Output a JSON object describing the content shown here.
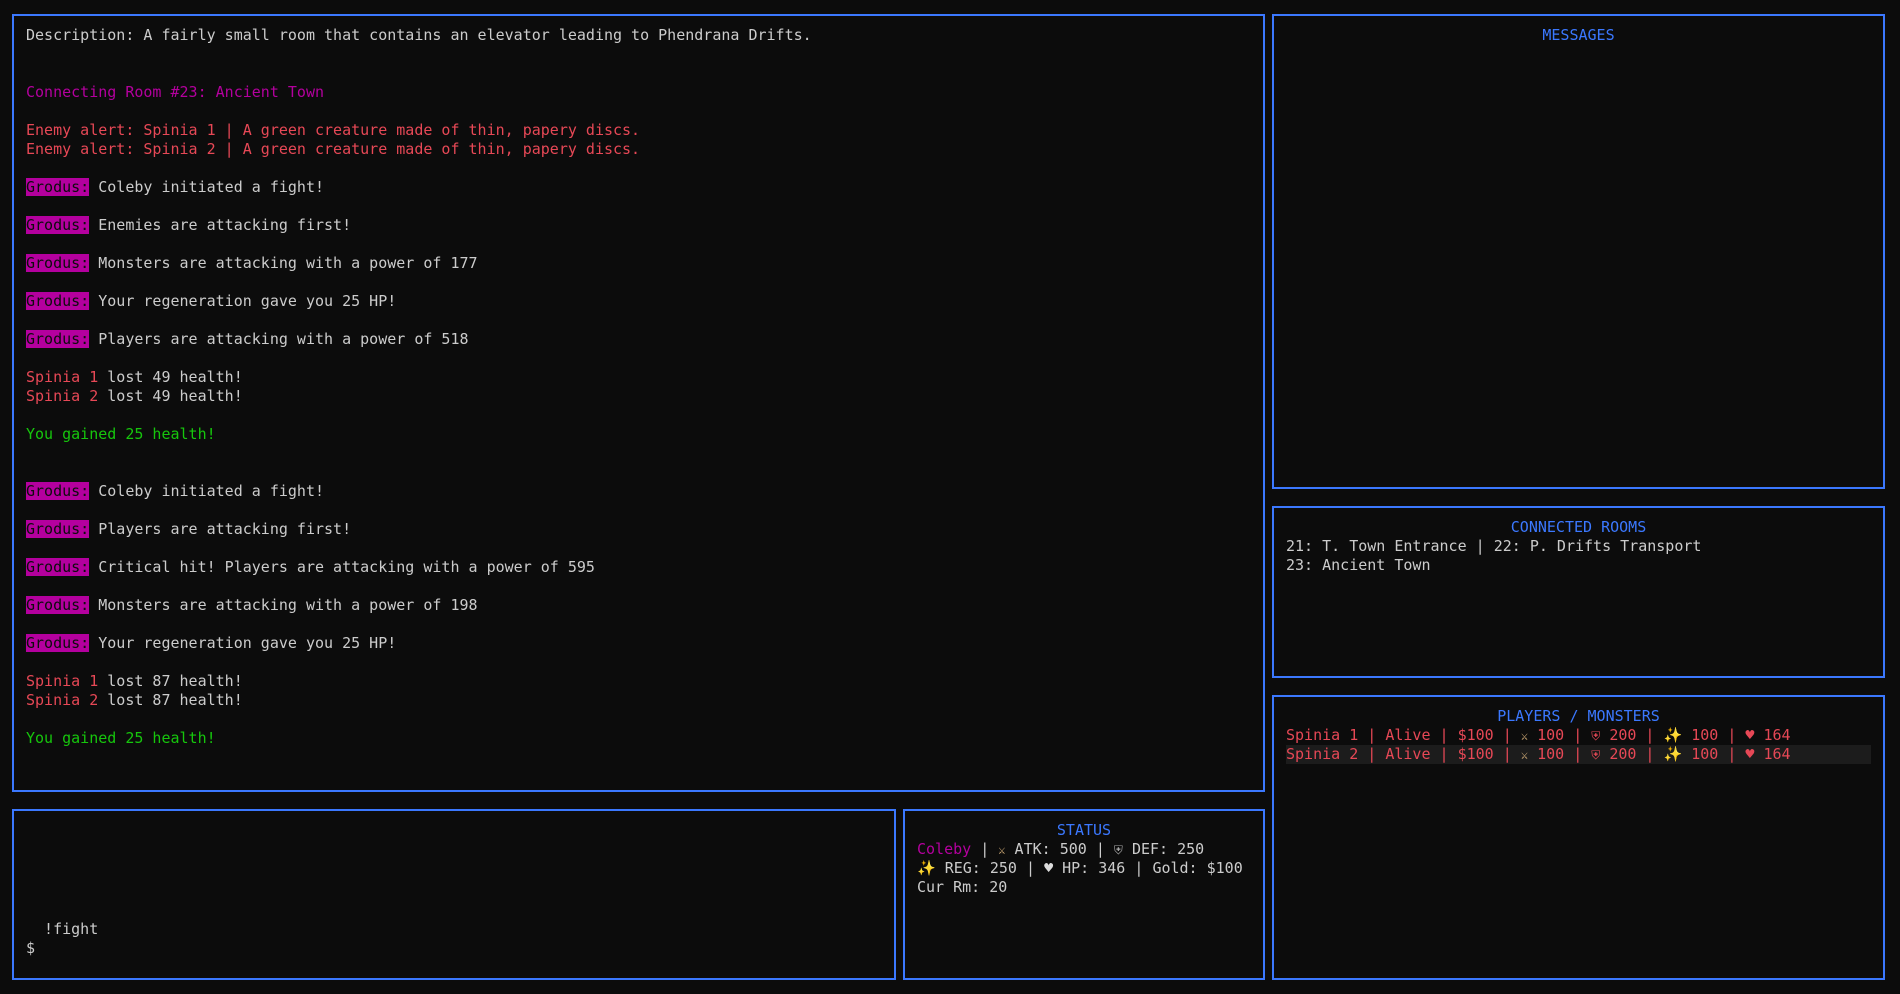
{
  "colors": {
    "border": "#3b78ff",
    "text": "#cccccc",
    "magenta": "#b4009e",
    "red": "#e74856",
    "green": "#16c60c",
    "background": "#0c0c0c"
  },
  "main": {
    "lines": [
      {
        "style": "plain",
        "text": "Description: A fairly small room that contains an elevator leading to Phendrana Drifts."
      },
      {
        "style": "blank"
      },
      {
        "style": "blank"
      },
      {
        "style": "magenta",
        "text": "Connecting Room #23: Ancient Town"
      },
      {
        "style": "blank"
      },
      {
        "style": "red",
        "text": "Enemy alert: Spinia 1 | A green creature made of thin, papery discs."
      },
      {
        "style": "red",
        "text": "Enemy alert: Spinia 2 | A green creature made of thin, papery discs."
      },
      {
        "style": "blank"
      },
      {
        "style": "tag",
        "tag": "Grodus:",
        "text": " Coleby initiated a fight!"
      },
      {
        "style": "blank"
      },
      {
        "style": "tag",
        "tag": "Grodus:",
        "text": " Enemies are attacking first!"
      },
      {
        "style": "blank"
      },
      {
        "style": "tag",
        "tag": "Grodus:",
        "text": " Monsters are attacking with a power of 177"
      },
      {
        "style": "blank"
      },
      {
        "style": "tag",
        "tag": "Grodus:",
        "text": " Your regeneration gave you 25 HP!"
      },
      {
        "style": "blank"
      },
      {
        "style": "tag",
        "tag": "Grodus:",
        "text": " Players are attacking with a power of 518"
      },
      {
        "style": "blank"
      },
      {
        "style": "loss",
        "name": "Spinia 1",
        "text": " lost 49 health!"
      },
      {
        "style": "loss",
        "name": "Spinia 2",
        "text": " lost 49 health!"
      },
      {
        "style": "blank"
      },
      {
        "style": "green",
        "text": "You gained 25 health!"
      },
      {
        "style": "blank"
      },
      {
        "style": "blank"
      },
      {
        "style": "tag",
        "tag": "Grodus:",
        "text": " Coleby initiated a fight!"
      },
      {
        "style": "blank"
      },
      {
        "style": "tag",
        "tag": "Grodus:",
        "text": " Players are attacking first!"
      },
      {
        "style": "blank"
      },
      {
        "style": "tag",
        "tag": "Grodus:",
        "text": " Critical hit! Players are attacking with a power of 595"
      },
      {
        "style": "blank"
      },
      {
        "style": "tag",
        "tag": "Grodus:",
        "text": " Monsters are attacking with a power of 198"
      },
      {
        "style": "blank"
      },
      {
        "style": "tag",
        "tag": "Grodus:",
        "text": " Your regeneration gave you 25 HP!"
      },
      {
        "style": "blank"
      },
      {
        "style": "loss",
        "name": "Spinia 1",
        "text": " lost 87 health!"
      },
      {
        "style": "loss",
        "name": "Spinia 2",
        "text": " lost 87 health!"
      },
      {
        "style": "blank"
      },
      {
        "style": "green",
        "text": "You gained 25 health!"
      }
    ]
  },
  "messages": {
    "title": "MESSAGES"
  },
  "rooms": {
    "title": "CONNECTED ROOMS",
    "lines": [
      "21: T. Town Entrance | 22: P. Drifts Transport",
      "23: Ancient Town"
    ]
  },
  "players": {
    "title": "PLAYERS / MONSTERS",
    "rows": [
      {
        "name": "Spinia 1",
        "state": "Alive",
        "gold": "$100",
        "atk": "100",
        "def": "200",
        "reg": "100",
        "hp": "164",
        "highlighted": false
      },
      {
        "name": "Spinia 2",
        "state": "Alive",
        "gold": "$100",
        "atk": "100",
        "def": "200",
        "reg": "100",
        "hp": "164",
        "highlighted": true
      }
    ]
  },
  "input": {
    "last_command": "  !fight",
    "prompt": "$"
  },
  "status": {
    "title": "STATUS",
    "player": "Coleby",
    "atk": "ATK: 500",
    "def": "DEF: 250",
    "reg": "REG: 250",
    "hp": "HP: 346",
    "gold": "Gold: $100",
    "room": "Cur Rm: 20"
  },
  "icons": {
    "atk": "crossed-swords-icon",
    "def": "shield-icon",
    "reg": "sparkles-icon",
    "hp": "heart-icon"
  }
}
